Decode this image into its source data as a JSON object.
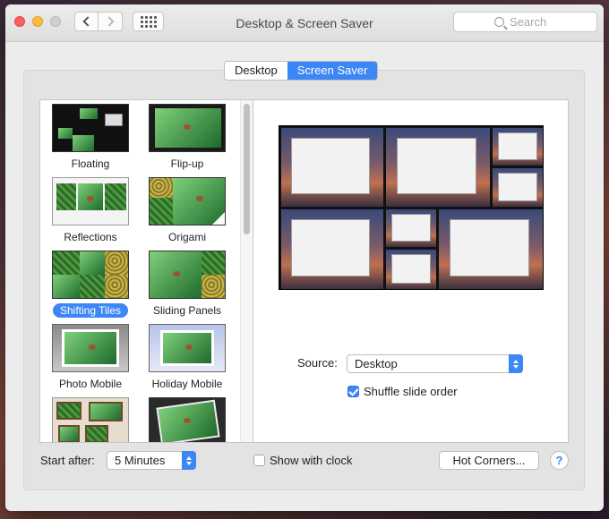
{
  "window": {
    "title": "Desktop & Screen Saver"
  },
  "search": {
    "placeholder": "Search"
  },
  "tabs": [
    {
      "label": "Desktop",
      "active": false
    },
    {
      "label": "Screen Saver",
      "active": true
    }
  ],
  "screensavers": [
    {
      "label": "Floating",
      "selected": false
    },
    {
      "label": "Flip-up",
      "selected": false
    },
    {
      "label": "Reflections",
      "selected": false
    },
    {
      "label": "Origami",
      "selected": false
    },
    {
      "label": "Shifting Tiles",
      "selected": true
    },
    {
      "label": "Sliding Panels",
      "selected": false
    },
    {
      "label": "Photo Mobile",
      "selected": false
    },
    {
      "label": "Holiday Mobile",
      "selected": false
    },
    {
      "label": "",
      "selected": false
    },
    {
      "label": "",
      "selected": false
    }
  ],
  "options": {
    "source_label": "Source:",
    "source_value": "Desktop",
    "shuffle_label": "Shuffle slide order",
    "shuffle_checked": true
  },
  "footer": {
    "start_after_label": "Start after:",
    "start_after_value": "5 Minutes",
    "show_clock_label": "Show with clock",
    "show_clock_checked": false,
    "hot_corners_label": "Hot Corners...",
    "help_label": "?"
  },
  "colors": {
    "accent": "#3c86f5",
    "window_bg": "#ececec"
  }
}
